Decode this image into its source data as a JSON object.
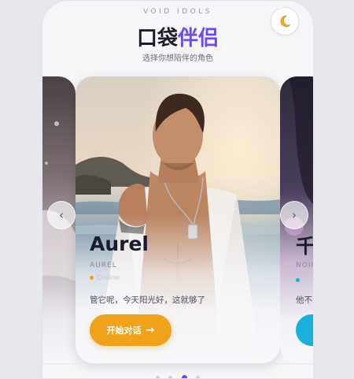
{
  "header": {
    "brand": "VOID IDOLS",
    "title_part1": "口袋",
    "title_part2": "伴侣",
    "subtitle": "选择你想陪伴的角色"
  },
  "theme_toggle": {
    "icon": "moon-icon"
  },
  "cards": {
    "main": {
      "name": "Aurel",
      "name_en": "AUREL",
      "status": "Online",
      "status_color": "#f0a21a",
      "quote": "管它呢，今天阳光好，这就够了",
      "cta_label": "开始对话",
      "cta_color": "#f0a21a"
    },
    "right": {
      "name": "千",
      "name_en": "NOIR",
      "status": "在",
      "status_color": "#1ab0d8",
      "quote": "他不",
      "cta_label": "开",
      "cta_color": "#1ab0d8"
    }
  },
  "nav": {
    "prev": "‹",
    "next": "›"
  },
  "pagination": {
    "count": 4,
    "active": 3
  },
  "colors": {
    "accent": "#7048e8",
    "background": "#f6f6f9"
  }
}
